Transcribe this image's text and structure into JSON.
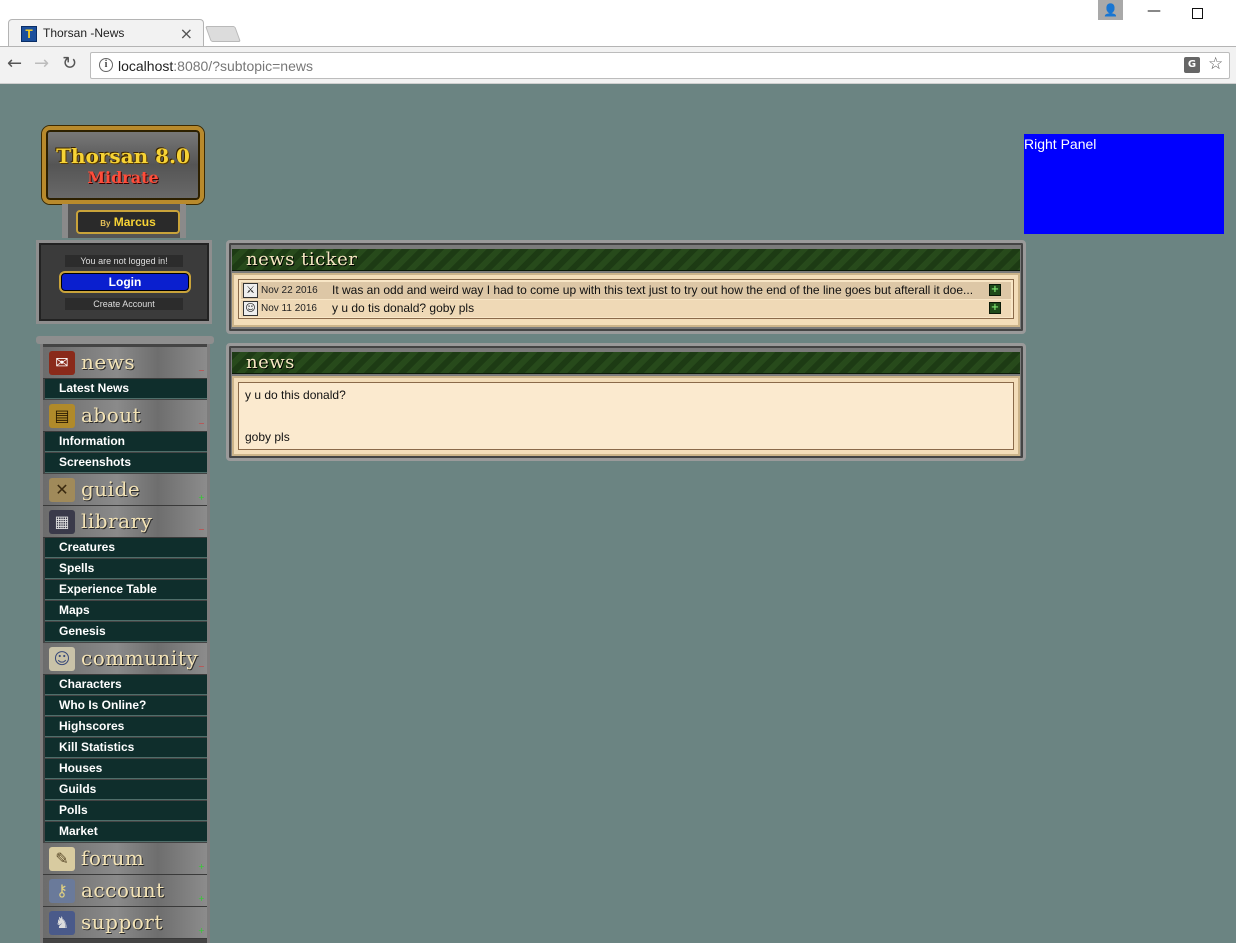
{
  "browser": {
    "tab_title": "Thorsan -News",
    "tab_favicon": "T",
    "url_host": "localhost",
    "url_rest": ":8080/?subtopic=news",
    "icons": {
      "back": "back-arrow-icon",
      "forward": "forward-arrow-icon",
      "reload": "reload-icon",
      "info": "info-icon",
      "translate": "translate-icon",
      "bookmark": "star-icon"
    }
  },
  "logo": {
    "title": "Thorsan 8.0",
    "subtitle": "Midrate",
    "by_prefix": "By",
    "author": "Marcus"
  },
  "login": {
    "status": "You are not logged in!",
    "login_label": "Login",
    "create_account_label": "Create Account"
  },
  "menu": {
    "news": {
      "label": "news",
      "items": [
        "Latest News"
      ]
    },
    "about": {
      "label": "about",
      "items": [
        "Information",
        "Screenshots"
      ]
    },
    "guide": {
      "label": "guide",
      "items": []
    },
    "library": {
      "label": "library",
      "items": [
        "Creatures",
        "Spells",
        "Experience Table",
        "Maps",
        "Genesis"
      ]
    },
    "community": {
      "label": "community",
      "items": [
        "Characters",
        "Who Is Online?",
        "Highscores",
        "Kill Statistics",
        "Houses",
        "Guilds",
        "Polls",
        "Market"
      ]
    },
    "forum": {
      "label": "forum",
      "items": []
    },
    "account": {
      "label": "account",
      "items": []
    },
    "support": {
      "label": "support",
      "items": []
    }
  },
  "right_panel": {
    "label": "Right Panel",
    "color": "#0000ff"
  },
  "news_ticker": {
    "title": "news ticker",
    "rows": [
      {
        "date": "Nov 22 2016",
        "text": "It was an odd and weird way I had to come up with this text just to try out how the end of the line goes but afterall it doe..."
      },
      {
        "date": "Nov 11 2016",
        "text": "y u do tis donald? goby pls"
      }
    ]
  },
  "news": {
    "title": "news",
    "line1": "y u do this donald?",
    "line2": "goby pls"
  },
  "colors": {
    "page_bg": "#6b8482",
    "menu_item_bg": "#0f2e2c",
    "box_header": "#1d3b14",
    "box_body": "#f3ddb9"
  }
}
